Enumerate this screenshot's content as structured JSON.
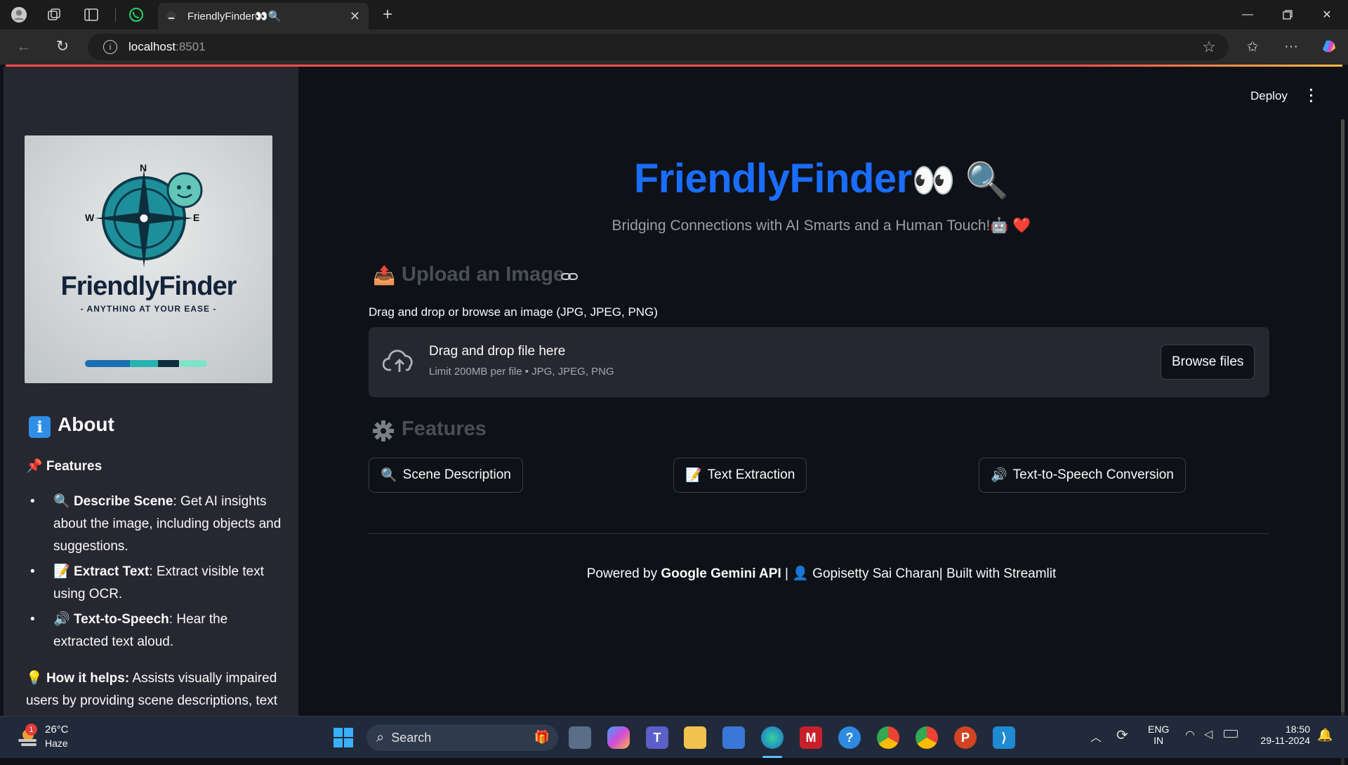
{
  "browser": {
    "tab_title": "FriendlyFinder👀🔍",
    "url_host": "localhost",
    "url_port": ":8501"
  },
  "header": {
    "deploy_label": "Deploy"
  },
  "sidebar": {
    "logo_brand": "FriendlyFinder",
    "logo_tagline": "- ANYTHING AT YOUR EASE -",
    "logo_compass": {
      "n": "N",
      "w": "W",
      "e": "E"
    },
    "about_heading": "About",
    "features_label": "📌 Features",
    "features": [
      {
        "icon": "🔍",
        "title": "Describe Scene",
        "text": ": Get AI insights about the image, including objects and suggestions."
      },
      {
        "icon": "📝",
        "title": "Extract Text",
        "text": ": Extract visible text using OCR."
      },
      {
        "icon": "🔊",
        "title": "Text-to-Speech",
        "text": ": Hear the extracted text aloud."
      }
    ],
    "how_icon": "💡",
    "how_title": "How it helps:",
    "how_text": " Assists visually impaired users by providing scene descriptions, text"
  },
  "main": {
    "title": "FriendlyFinder",
    "title_emoji": "👀 🔍",
    "subtitle": "Bridging Connections with AI Smarts and a Human Touch!🤖 ❤️",
    "upload_heading": "Upload an Image",
    "upload_icon": "📤",
    "upload_label": "Drag and drop or browse an image (JPG, JPEG, PNG)",
    "dropzone_title": "Drag and drop file here",
    "dropzone_limit": "Limit 200MB per file • JPG, JPEG, PNG",
    "browse_label": "Browse files",
    "features_heading": "Features",
    "buttons": [
      {
        "icon": "🔍",
        "label": "Scene Description"
      },
      {
        "icon": "📝",
        "label": "Text Extraction"
      },
      {
        "icon": "🔊",
        "label": "Text-to-Speech Conversion"
      }
    ],
    "footer_prefix": "Powered by ",
    "footer_api": "Google Gemini API",
    "footer_sep": " | ",
    "footer_author_icon": "👤",
    "footer_rest": " Gopisetty Sai Charan| Built with Streamlit"
  },
  "taskbar": {
    "weather_temp": "26°C",
    "weather_desc": "Haze",
    "weather_badge": "1",
    "search_label": "Search",
    "lang_top": "ENG",
    "lang_bottom": "IN",
    "time": "18:50",
    "date": "29-11-2024"
  },
  "colors": {
    "accent_blue": "#1a6dff",
    "streamlit_red": "#ff4b4b",
    "sidebar_bg": "#262730",
    "main_bg": "#0e1117"
  }
}
